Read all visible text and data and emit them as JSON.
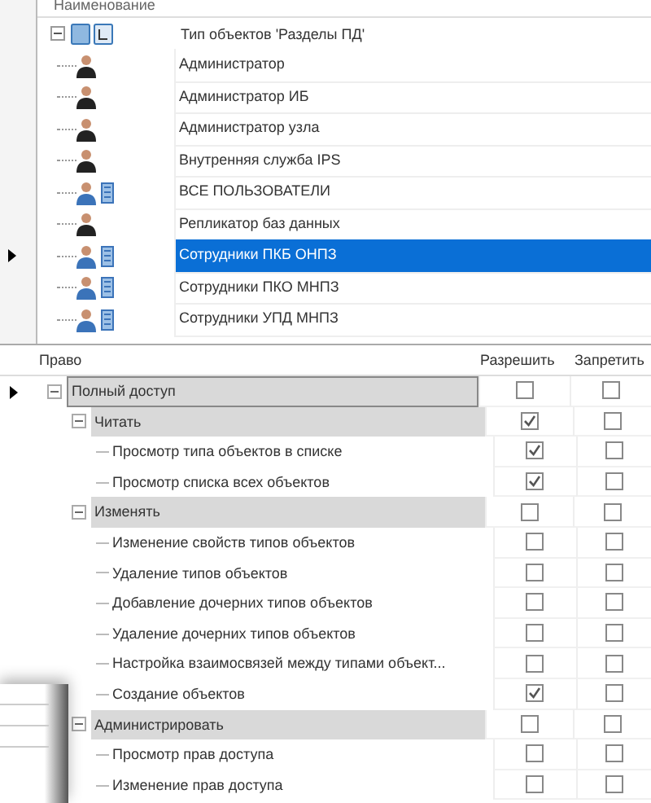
{
  "objects_tree": {
    "header": "Наименование",
    "root": {
      "label": "Тип объектов 'Разделы ПД'",
      "expanded": true,
      "children": [
        {
          "label": "Администратор",
          "kind": "user",
          "selected": false
        },
        {
          "label": "Администратор ИБ",
          "kind": "user",
          "selected": false
        },
        {
          "label": "Администратор узла",
          "kind": "user",
          "selected": false
        },
        {
          "label": "Внутренняя служба IPS",
          "kind": "user",
          "selected": false
        },
        {
          "label": "ВСЕ ПОЛЬЗОВАТЕЛИ",
          "kind": "group",
          "selected": false
        },
        {
          "label": "Репликатор баз данных",
          "kind": "user",
          "selected": false
        },
        {
          "label": "Сотрудники ПКБ ОНПЗ",
          "kind": "group",
          "selected": true
        },
        {
          "label": "Сотрудники ПКО МНПЗ",
          "kind": "group",
          "selected": false
        },
        {
          "label": "Сотрудники УПД МНПЗ",
          "kind": "group",
          "selected": false
        }
      ]
    }
  },
  "rights_grid": {
    "columns": [
      "Право",
      "Разрешить",
      "Запретить"
    ],
    "rows": [
      {
        "label": "Полный доступ",
        "allow": false,
        "deny": false,
        "expanded": true,
        "selected": true,
        "children": [
          {
            "label": "Читать",
            "allow": true,
            "deny": false,
            "expanded": true,
            "selected": false,
            "children": [
              {
                "label": "Просмотр типа объектов в списке",
                "allow": true,
                "deny": false,
                "selected": false
              },
              {
                "label": "Просмотр списка всех объектов",
                "allow": true,
                "deny": false,
                "selected": false
              }
            ]
          },
          {
            "label": "Изменять",
            "allow": false,
            "deny": false,
            "expanded": true,
            "selected": false,
            "children": [
              {
                "label": "Изменение свойств типов объектов",
                "allow": false,
                "deny": false,
                "selected": false
              },
              {
                "label": "Удаление типов объектов",
                "allow": false,
                "deny": false,
                "selected": false
              },
              {
                "label": "Добавление дочерних типов объектов",
                "allow": false,
                "deny": false,
                "selected": false
              },
              {
                "label": "Удаление дочерних типов объектов",
                "allow": false,
                "deny": false,
                "selected": false
              },
              {
                "label": "Настройка взаимосвязей между типами объект...",
                "allow": false,
                "deny": false,
                "selected": false
              },
              {
                "label": "Создание объектов",
                "allow": true,
                "deny": false,
                "selected": false
              }
            ]
          },
          {
            "label": "Администрировать",
            "allow": false,
            "deny": false,
            "expanded": true,
            "selected": false,
            "children": [
              {
                "label": "Просмотр прав доступа",
                "allow": false,
                "deny": false,
                "selected": false
              },
              {
                "label": "Изменение прав доступа",
                "allow": false,
                "deny": false,
                "selected": false
              }
            ]
          }
        ]
      }
    ]
  }
}
